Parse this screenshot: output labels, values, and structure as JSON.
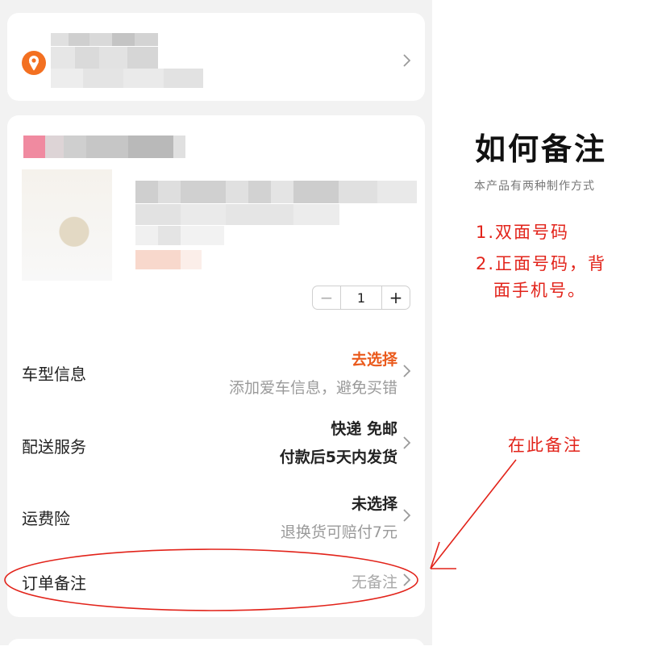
{
  "address": {
    "icon": "location-pin-icon",
    "icon_color": "#f37021"
  },
  "product": {
    "quantity": "1"
  },
  "options": [
    {
      "label": "车型信息",
      "value_main": "去选择",
      "value_sub": "添加爱车信息，避免买错"
    },
    {
      "label": "配送服务",
      "value_main": "快递 免邮",
      "value_sub": "付款后5天内发货"
    },
    {
      "label": "运费险",
      "value_main": "未选择",
      "value_sub": "退换货可赔付7元"
    },
    {
      "label": "订单备注",
      "value_main": "无备注"
    }
  ],
  "instructions": {
    "title": "如何备注",
    "subtitle": "本产品有两种制作方式",
    "lines": [
      "1.双面号码",
      "2.正面号码，背",
      "面手机号。"
    ],
    "callout": "在此备注"
  },
  "colors": {
    "accent_orange": "#ea5a1c",
    "annotation_red": "#e2231a",
    "background": "#f2f2f2"
  }
}
